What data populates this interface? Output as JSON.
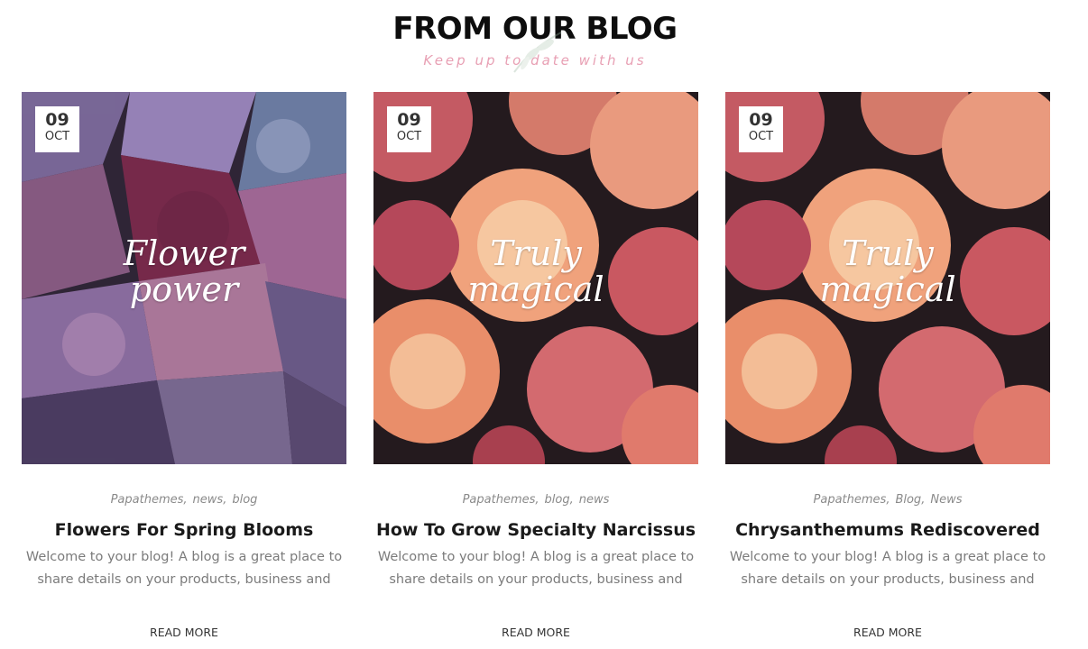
{
  "section": {
    "title": "FROM OUR BLOG",
    "subtitle": "Keep up to date with us",
    "subtitle_color": "#e8a0b4"
  },
  "posts": [
    {
      "day": "09",
      "month": "OCT",
      "image_text_line1": "Flower",
      "image_text_line2": "power",
      "image_theme": "hydrangea",
      "tags": [
        "Papathemes",
        "news",
        "blog"
      ],
      "title": "Flowers For Spring Blooms",
      "excerpt": "Welcome to your blog! A blog is a great place to share details on your products, business and",
      "read_more": "READ MORE"
    },
    {
      "day": "09",
      "month": "OCT",
      "image_text_line1": "Truly",
      "image_text_line2": "magical",
      "image_theme": "roses",
      "tags": [
        "Papathemes",
        "blog",
        "news"
      ],
      "title": "How To Grow Specialty Narcissus",
      "excerpt": "Welcome to your blog! A blog is a great place to share details on your products, business and",
      "read_more": "READ MORE"
    },
    {
      "day": "09",
      "month": "OCT",
      "image_text_line1": "Truly",
      "image_text_line2": "magical",
      "image_theme": "roses",
      "tags": [
        "Papathemes",
        "Blog",
        "News"
      ],
      "title": "Chrysanthemums Rediscovered",
      "excerpt": "Welcome to your blog! A blog is a great place to share details on your products, business and whate",
      "read_more": "READ MORE"
    }
  ]
}
